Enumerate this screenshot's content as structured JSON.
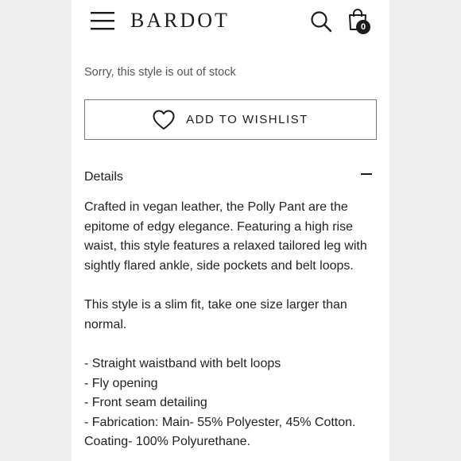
{
  "header": {
    "logo": "BARDOT",
    "cart_count": "0"
  },
  "product": {
    "stock_message": "Sorry, this style is out of stock",
    "wishlist_label": "ADD TO WISHLIST"
  },
  "details": {
    "title": "Details",
    "paragraph1": "Crafted in vegan leather, the Polly Pant are the epitome of edgy elegance. Featuring a high rise waist, this style features a relaxed tailored leg with sightly flared ankle, side pockets and belt loops.",
    "paragraph2": "This style is a slim fit, take one size larger than normal.",
    "bullets": [
      "- Straight waistband with belt loops",
      "- Fly opening",
      "- Front seam detailing",
      "- Fabrication: Main- 55% Polyester, 45% Cotton. Coating- 100% Polyurethane."
    ]
  },
  "icons": {
    "menu": "hamburger-menu-icon",
    "search": "search-icon",
    "bag": "shopping-bag-icon",
    "wishlist": "heart-icon",
    "collapse": "minus-icon"
  },
  "colors": {
    "text": "#1c1c1c",
    "muted": "#555555",
    "border": "#7a7a7a",
    "background": "#ffffff",
    "outer_background": "#efefef"
  }
}
